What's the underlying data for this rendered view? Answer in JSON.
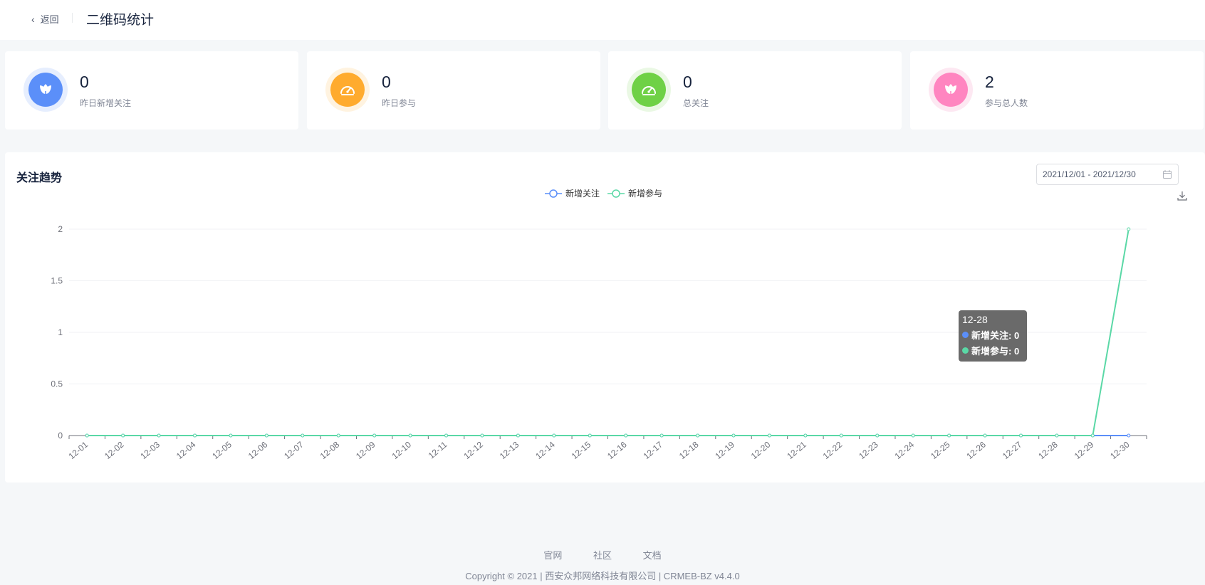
{
  "header": {
    "back_label": "返回",
    "title": "二维码统计"
  },
  "stats": [
    {
      "value": "0",
      "label": "昨日新增关注",
      "color": "#5b8ff9",
      "ring": "#e6eefe",
      "icon": "flower-icon"
    },
    {
      "value": "0",
      "label": "昨日参与",
      "color": "#ffab2e",
      "ring": "#fff3e0",
      "icon": "dashboard-icon"
    },
    {
      "value": "0",
      "label": "总关注",
      "color": "#6fd146",
      "ring": "#eaf8e4",
      "icon": "dashboard-icon"
    },
    {
      "value": "2",
      "label": "参与总人数",
      "color": "#ff85c0",
      "ring": "#fde8f2",
      "icon": "flower-icon"
    }
  ],
  "trend": {
    "title": "关注趋势",
    "date_range": "2021/12/01 - 2021/12/30",
    "icons": {
      "calendar": "calendar-icon",
      "download": "download-icon"
    }
  },
  "chart_data": {
    "type": "line",
    "title": "关注趋势",
    "x": [
      "12-01",
      "12-02",
      "12-03",
      "12-04",
      "12-05",
      "12-06",
      "12-07",
      "12-08",
      "12-09",
      "12-10",
      "12-11",
      "12-12",
      "12-13",
      "12-14",
      "12-15",
      "12-16",
      "12-17",
      "12-18",
      "12-19",
      "12-20",
      "12-21",
      "12-22",
      "12-23",
      "12-24",
      "12-25",
      "12-26",
      "12-27",
      "12-28",
      "12-29",
      "12-30"
    ],
    "series": [
      {
        "name": "新增关注",
        "color": "#5b8ff9",
        "values": [
          0,
          0,
          0,
          0,
          0,
          0,
          0,
          0,
          0,
          0,
          0,
          0,
          0,
          0,
          0,
          0,
          0,
          0,
          0,
          0,
          0,
          0,
          0,
          0,
          0,
          0,
          0,
          0,
          0,
          0
        ]
      },
      {
        "name": "新增参与",
        "color": "#5ad8a6",
        "values": [
          0,
          0,
          0,
          0,
          0,
          0,
          0,
          0,
          0,
          0,
          0,
          0,
          0,
          0,
          0,
          0,
          0,
          0,
          0,
          0,
          0,
          0,
          0,
          0,
          0,
          0,
          0,
          0,
          0,
          2
        ]
      }
    ],
    "yticks": [
      "0",
      "0.5",
      "1",
      "1.5",
      "2"
    ],
    "ylim": [
      0,
      2
    ],
    "grid": true,
    "legend_position": "top-center"
  },
  "tooltip": {
    "title": "12-28",
    "rows": [
      {
        "label": "新增关注: 0",
        "color": "#5b8ff9"
      },
      {
        "label": "新增参与: 0",
        "color": "#5ad8a6"
      }
    ]
  },
  "footer": {
    "links": [
      "官网",
      "社区",
      "文档"
    ],
    "copyright": "Copyright © 2021 | 西安众邦网络科技有限公司 | CRMEB-BZ v4.4.0"
  }
}
